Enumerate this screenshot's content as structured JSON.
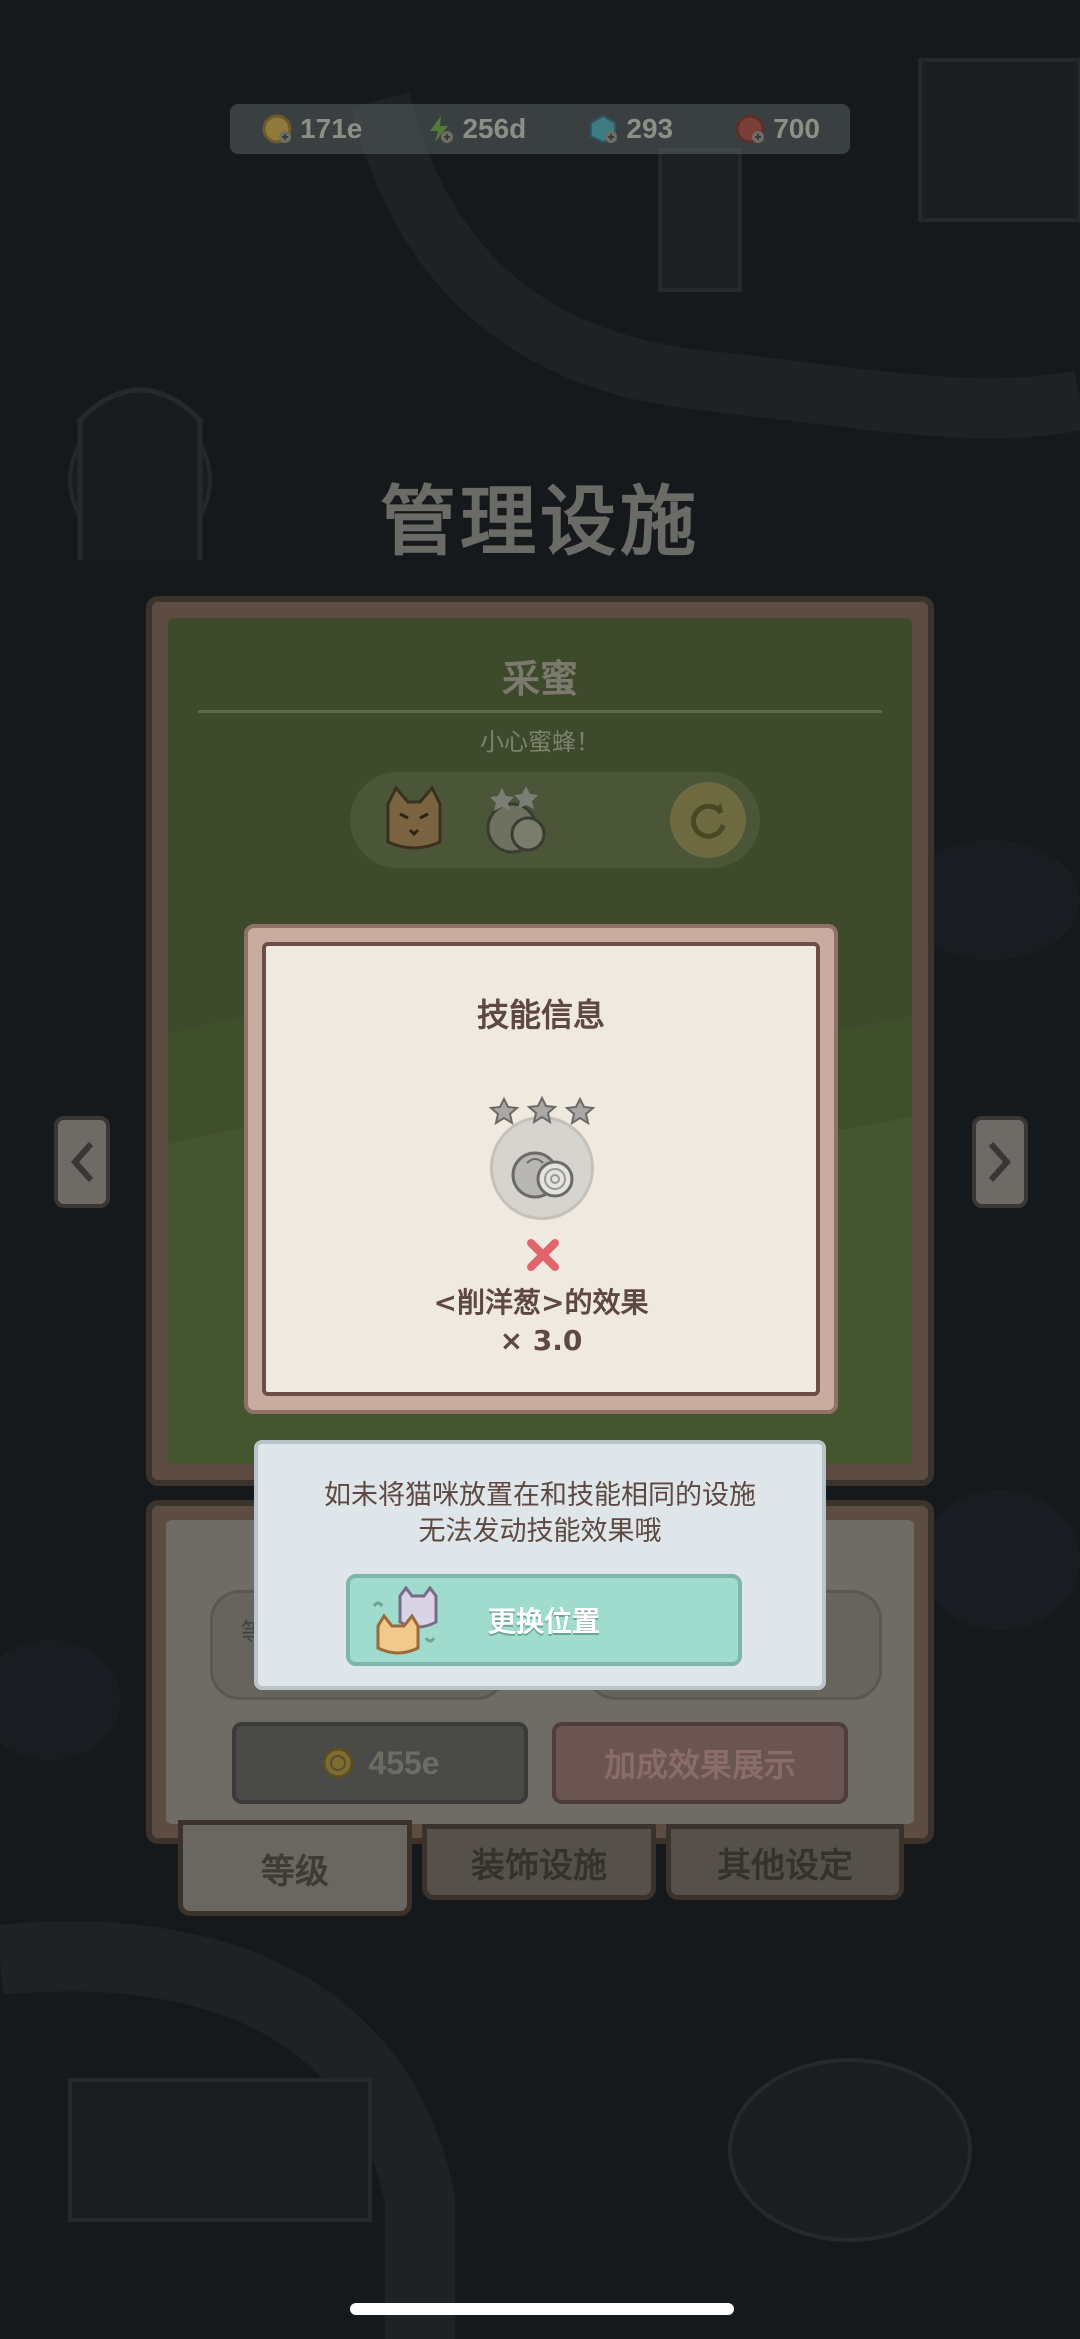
{
  "resources": [
    {
      "icon": "gold-coin-icon",
      "value": "171e"
    },
    {
      "icon": "lightning-icon",
      "value": "256d"
    },
    {
      "icon": "blue-cube-icon",
      "value": "293"
    },
    {
      "icon": "red-ticket-icon",
      "value": "700"
    }
  ],
  "page_title": "管理设施",
  "facility": {
    "name": "采蜜",
    "subtitle": "小心蜜蜂！"
  },
  "lower_panel": {
    "level_label": "等",
    "cost": "455e",
    "bonus_button": "加成效果展示"
  },
  "tabs": [
    {
      "label": "等级",
      "active": true
    },
    {
      "label": "装饰设施",
      "active": false
    },
    {
      "label": "其他设定",
      "active": false
    }
  ],
  "skill_dialog": {
    "title": "技能信息",
    "effect_line": "<削洋葱>的效果",
    "multiplier": "× 3.0"
  },
  "info_dialog": {
    "line1": "如未将猫咪放置在和技能相同的设施",
    "line2": "无法发动技能效果哦",
    "button": "更换位置"
  },
  "colors": {
    "dialog_bg": "#efe9df",
    "dialog_border": "#c8aca0",
    "swap_button": "#9fdccd",
    "accent_text": "#5e4842",
    "x_mark": "#e0666e"
  }
}
